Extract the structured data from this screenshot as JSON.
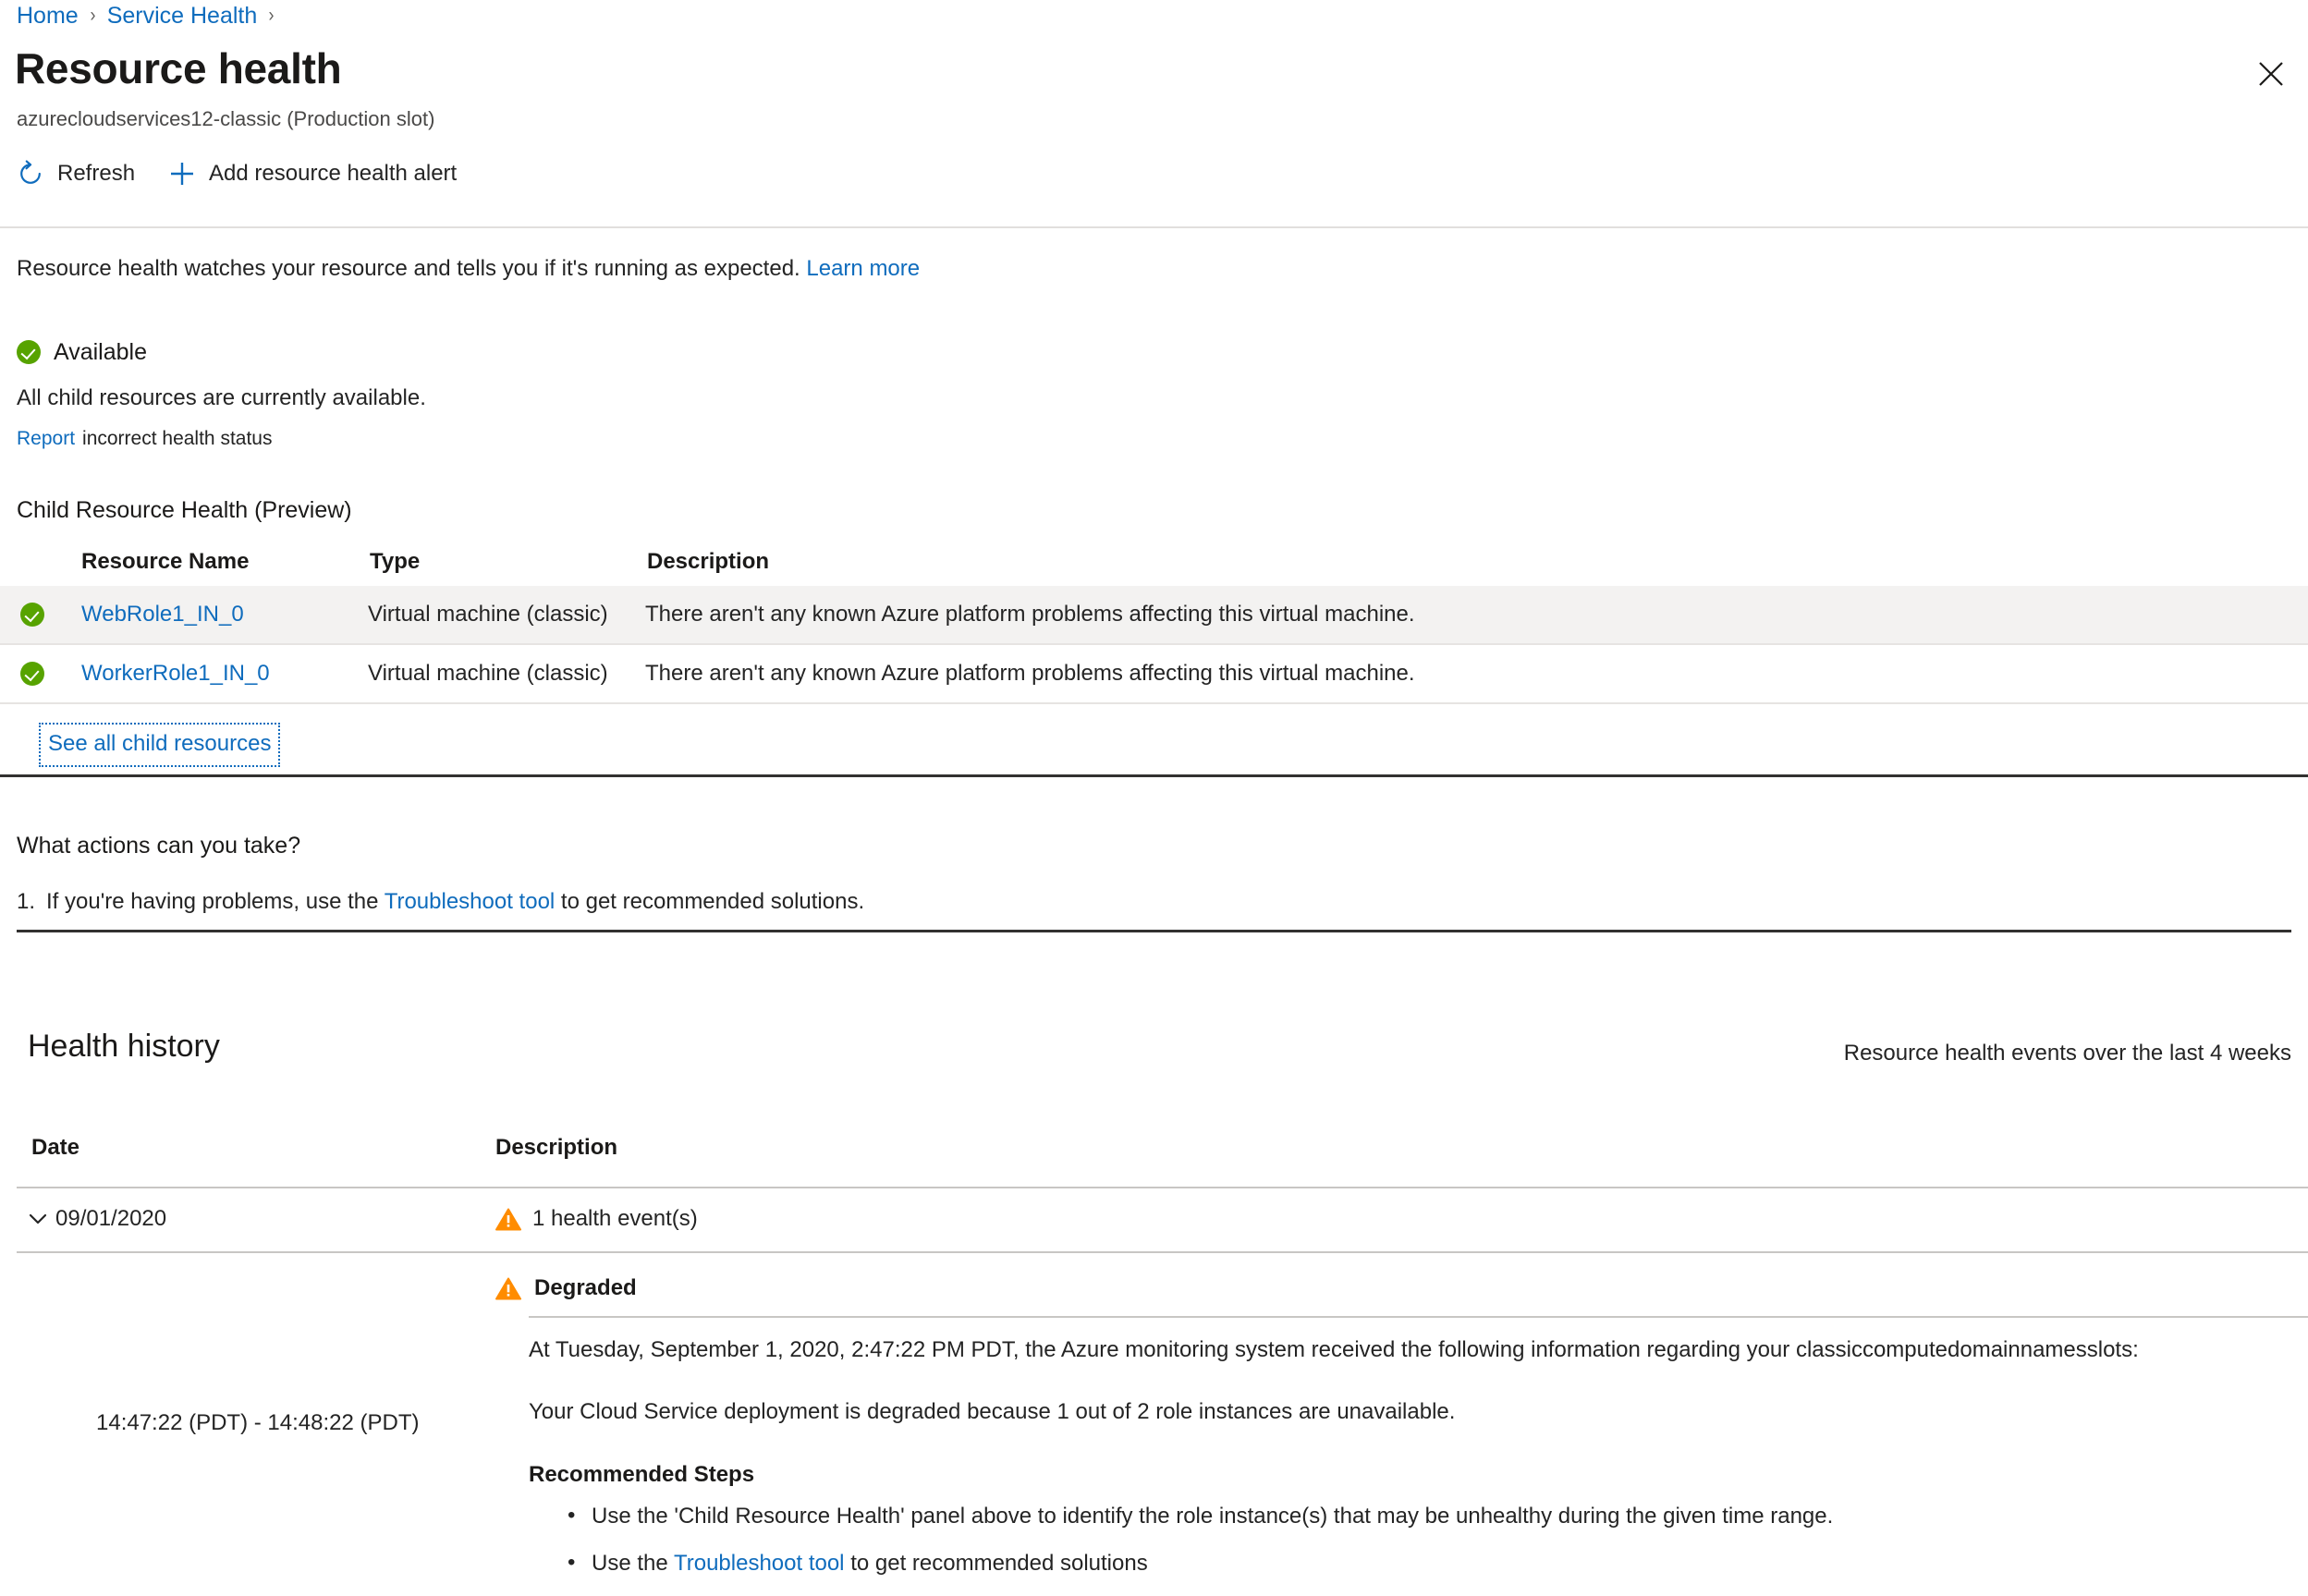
{
  "breadcrumb": {
    "items": [
      {
        "label": "Home"
      },
      {
        "label": "Service Health"
      }
    ],
    "separator": "›"
  },
  "header": {
    "title": "Resource health",
    "subtitle": "azurecloudservices12-classic (Production slot)",
    "close_label": "Close"
  },
  "toolbar": {
    "refresh_label": "Refresh",
    "add_alert_label": "Add resource health alert"
  },
  "intro": {
    "text": "Resource health watches your resource and tells you if it's running as expected.",
    "learn_more": "Learn more"
  },
  "availability": {
    "status": "Available",
    "description": "All child resources are currently available.",
    "report_link": "Report",
    "report_rest": "incorrect health status",
    "status_color": "#57a300"
  },
  "child_health": {
    "title": "Child Resource Health (Preview)",
    "columns": [
      "Resource Name",
      "Type",
      "Description"
    ],
    "rows": [
      {
        "name": "WebRole1_IN_0",
        "type": "Virtual machine (classic)",
        "description": "There aren't any known Azure platform problems affecting this virtual machine.",
        "status": "available"
      },
      {
        "name": "WorkerRole1_IN_0",
        "type": "Virtual machine (classic)",
        "description": "There aren't any known Azure platform problems affecting this virtual machine.",
        "status": "available"
      }
    ],
    "see_all_label": "See all child resources"
  },
  "actions": {
    "title": "What actions can you take?",
    "item_number": "1.",
    "item_before": "If you're having problems, use the",
    "item_link": "Troubleshoot tool",
    "item_after": "to get recommended solutions."
  },
  "health_history": {
    "title": "Health history",
    "subtitle": "Resource health events over the last 4 weeks",
    "columns": [
      "Date",
      "Description"
    ],
    "date_row": {
      "date": "09/01/2020",
      "event_count_label": "1 health event(s)"
    },
    "event": {
      "time_range": "14:47:22 (PDT) - 14:48:22 (PDT)",
      "status": "Degraded",
      "status_color": "#ff8c00",
      "paragraph_1": "At Tuesday, September 1, 2020, 2:47:22 PM PDT, the Azure monitoring system received the following information regarding your classiccomputedomainnamesslots:",
      "paragraph_2": "Your Cloud Service deployment is degraded because 1 out of 2 role instances are unavailable.",
      "steps_title": "Recommended Steps",
      "steps": [
        {
          "before": "Use the 'Child Resource Health' panel above to identify the role instance(s) that may be unhealthy during the given time range.",
          "link": "",
          "after": ""
        },
        {
          "before": "Use the",
          "link": "Troubleshoot tool",
          "after": "to get recommended solutions"
        }
      ]
    }
  },
  "colors": {
    "link": "#0f6cbd",
    "success": "#57a300",
    "warning": "#ff8c00",
    "row_alt": "#f3f2f1"
  }
}
